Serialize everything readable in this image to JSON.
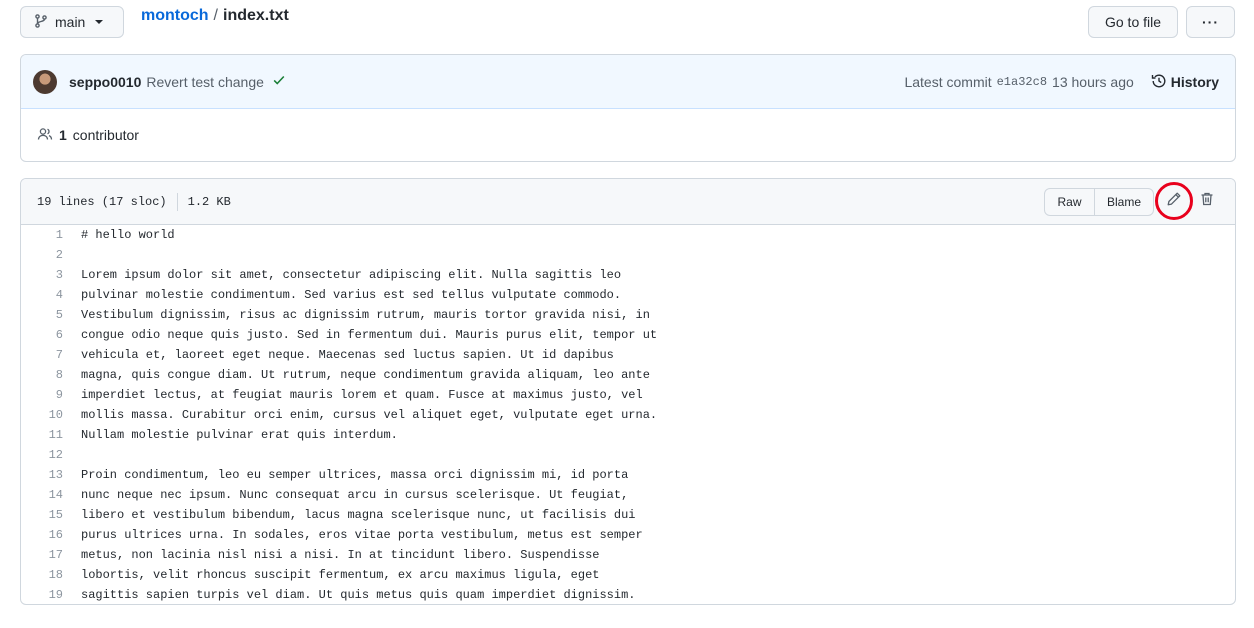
{
  "branch": {
    "label": "main"
  },
  "breadcrumb": {
    "repo": "montoch",
    "separator": "/",
    "file": "index.txt"
  },
  "actions": {
    "go_to_file": "Go to file",
    "more": "···"
  },
  "commit": {
    "author": "seppo0010",
    "message": "Revert test change",
    "status": "success",
    "latest_label": "Latest commit",
    "sha": "e1a32c8",
    "time": "13 hours ago",
    "history_label": "History"
  },
  "contributors": {
    "count": "1",
    "label": "contributor"
  },
  "file_info": {
    "lines": "19 lines (17 sloc)",
    "size": "1.2 KB"
  },
  "file_actions": {
    "raw": "Raw",
    "blame": "Blame",
    "edit_icon": "pencil-icon",
    "delete_icon": "trash-icon"
  },
  "code_lines": [
    {
      "n": "1",
      "text": "# hello world"
    },
    {
      "n": "2",
      "text": ""
    },
    {
      "n": "3",
      "text": "Lorem ipsum dolor sit amet, consectetur adipiscing elit. Nulla sagittis leo"
    },
    {
      "n": "4",
      "text": "pulvinar molestie condimentum. Sed varius est sed tellus vulputate commodo."
    },
    {
      "n": "5",
      "text": "Vestibulum dignissim, risus ac dignissim rutrum, mauris tortor gravida nisi, in"
    },
    {
      "n": "6",
      "text": "congue odio neque quis justo. Sed in fermentum dui. Mauris purus elit, tempor ut"
    },
    {
      "n": "7",
      "text": "vehicula et, laoreet eget neque. Maecenas sed luctus sapien. Ut id dapibus"
    },
    {
      "n": "8",
      "text": "magna, quis congue diam. Ut rutrum, neque condimentum gravida aliquam, leo ante"
    },
    {
      "n": "9",
      "text": "imperdiet lectus, at feugiat mauris lorem et quam. Fusce at maximus justo, vel"
    },
    {
      "n": "10",
      "text": "mollis massa. Curabitur orci enim, cursus vel aliquet eget, vulputate eget urna."
    },
    {
      "n": "11",
      "text": "Nullam molestie pulvinar erat quis interdum."
    },
    {
      "n": "12",
      "text": ""
    },
    {
      "n": "13",
      "text": "Proin condimentum, leo eu semper ultrices, massa orci dignissim mi, id porta"
    },
    {
      "n": "14",
      "text": "nunc neque nec ipsum. Nunc consequat arcu in cursus scelerisque. Ut feugiat,"
    },
    {
      "n": "15",
      "text": "libero et vestibulum bibendum, lacus magna scelerisque nunc, ut facilisis dui"
    },
    {
      "n": "16",
      "text": "purus ultrices urna. In sodales, eros vitae porta vestibulum, metus est semper"
    },
    {
      "n": "17",
      "text": "metus, non lacinia nisl nisi a nisi. In at tincidunt libero. Suspendisse"
    },
    {
      "n": "18",
      "text": "lobortis, velit rhoncus suscipit fermentum, ex arcu maximus ligula, eget"
    },
    {
      "n": "19",
      "text": "sagittis sapien turpis vel diam. Ut quis metus quis quam imperdiet dignissim."
    }
  ],
  "colors": {
    "link": "#0969da",
    "success": "#1a7f37",
    "highlight_circle": "#e8001c"
  }
}
